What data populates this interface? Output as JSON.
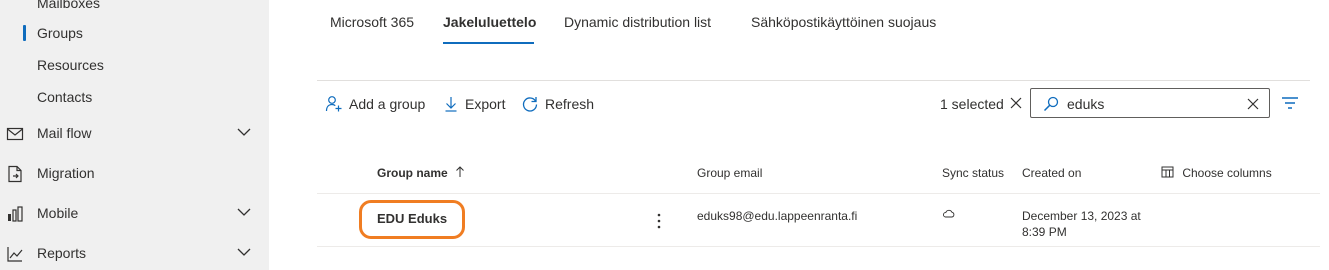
{
  "sidebar": {
    "items": [
      {
        "label": "Mailboxes"
      },
      {
        "label": "Groups"
      },
      {
        "label": "Resources"
      },
      {
        "label": "Contacts"
      },
      {
        "label": "Mail flow"
      },
      {
        "label": "Migration"
      },
      {
        "label": "Mobile"
      },
      {
        "label": "Reports"
      }
    ]
  },
  "tabs": [
    {
      "label": "Microsoft 365"
    },
    {
      "label": "Jakeluluettelo"
    },
    {
      "label": "Dynamic distribution list"
    },
    {
      "label": "Sähköpostikäyttöinen suojaus"
    }
  ],
  "toolbar": {
    "add_group": "Add a group",
    "export": "Export",
    "refresh": "Refresh",
    "selected": "1 selected"
  },
  "search": {
    "value": "eduks"
  },
  "table": {
    "headers": {
      "group_name": "Group name",
      "group_email": "Group email",
      "sync_status": "Sync status",
      "created_on": "Created on",
      "choose_columns": "Choose columns"
    },
    "rows": [
      {
        "group_name": "EDU Eduks",
        "group_email": "eduks98@edu.lappeenranta.fi",
        "created_on_line1": "December 13, 2023 at",
        "created_on_line2": "8:39 PM"
      }
    ]
  },
  "colors": {
    "accent": "#0f6cbd",
    "highlight": "#f07d22",
    "sidebar_bg": "#f0f0f0"
  }
}
